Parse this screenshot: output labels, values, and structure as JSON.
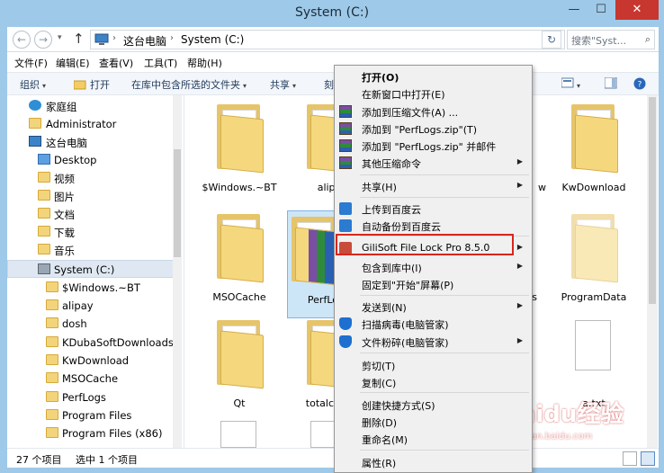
{
  "window": {
    "title": "System (C:)"
  },
  "titlebar": {
    "min_icon": "—",
    "max_icon": "☐",
    "close_icon": "✕"
  },
  "address": {
    "back_icon": "←",
    "forward_icon": "→",
    "recent_icon": "▾",
    "up_icon": "↑",
    "breadcrumbs": [
      "这台电脑",
      "System (C:)"
    ],
    "sep_icon": "›",
    "dropdown_icon": "▾",
    "refresh_icon": "↻",
    "search_placeholder": "搜索\"Syst...",
    "search_icon": "⌕"
  },
  "menubar": {
    "items": [
      "文件(F)",
      "编辑(E)",
      "查看(V)",
      "工具(T)",
      "帮助(H)"
    ]
  },
  "toolbar": {
    "organize": "组织",
    "open": "打开",
    "include_in_library": "在库中包含所选的文件夹",
    "share": "共享",
    "burn": "刻",
    "arrow": "▾"
  },
  "navpane": {
    "items": [
      {
        "label": "家庭组",
        "kind": "homegroup"
      },
      {
        "label": "Administrator",
        "kind": "user"
      },
      {
        "label": "这台电脑",
        "kind": "pc"
      },
      {
        "label": "Desktop",
        "kind": "folder"
      },
      {
        "label": "视频",
        "kind": "folder"
      },
      {
        "label": "图片",
        "kind": "folder"
      },
      {
        "label": "文档",
        "kind": "folder"
      },
      {
        "label": "下载",
        "kind": "folder"
      },
      {
        "label": "音乐",
        "kind": "folder"
      },
      {
        "label": "System (C:)",
        "kind": "drive"
      },
      {
        "label": "$Windows.~BT",
        "kind": "folder"
      },
      {
        "label": "alipay",
        "kind": "folder"
      },
      {
        "label": "dosh",
        "kind": "folder"
      },
      {
        "label": "KDubaSoftDownloads",
        "kind": "folder"
      },
      {
        "label": "KwDownload",
        "kind": "folder"
      },
      {
        "label": "MSOCache",
        "kind": "folder"
      },
      {
        "label": "PerfLogs",
        "kind": "folder"
      },
      {
        "label": "Program Files",
        "kind": "folder"
      },
      {
        "label": "Program Files (x86)",
        "kind": "folder"
      }
    ]
  },
  "content": {
    "tiles": [
      {
        "label": "$Windows.~BT"
      },
      {
        "label": "alipa"
      },
      {
        "label": "w"
      },
      {
        "label": "KwDownload"
      },
      {
        "label": "MSOCache"
      },
      {
        "label": "PerfLo"
      },
      {
        "label": "s"
      },
      {
        "label": "ProgramData"
      },
      {
        "label": "Qt"
      },
      {
        "label": "totalc"
      },
      {
        "label": "a.txt"
      }
    ]
  },
  "status": {
    "item_count": "27 个项目",
    "selected": "选中 1 个项目"
  },
  "context_menu": {
    "items": [
      {
        "label": "打开(O)",
        "bold": true
      },
      {
        "label": "在新窗口中打开(E)"
      },
      {
        "label": "添加到压缩文件(A) ...",
        "icon": "rar-icon"
      },
      {
        "label": "添加到 \"PerfLogs.zip\"(T)",
        "icon": "rar-icon"
      },
      {
        "label": "添加到 \"PerfLogs.zip\" 并邮件",
        "icon": "rar-icon"
      },
      {
        "label": "其他压缩命令",
        "icon": "rar-icon",
        "submenu": true
      },
      {
        "label": "共享(H)",
        "submenu": true
      },
      {
        "label": "上传到百度云",
        "icon": "baidu-cloud-icon"
      },
      {
        "label": "自动备份到百度云",
        "icon": "baidu-cloud-icon"
      },
      {
        "label": "GiliSoft File Lock Pro 8.5.0",
        "icon": "lock-icon",
        "submenu": true
      },
      {
        "label": "包含到库中(I)",
        "submenu": true
      },
      {
        "label": "固定到\"开始\"屏幕(P)"
      },
      {
        "label": "发送到(N)",
        "submenu": true
      },
      {
        "label": "扫描病毒(电脑管家)",
        "icon": "shield-icon"
      },
      {
        "label": "文件粉碎(电脑管家)",
        "icon": "shield-icon",
        "submenu": true
      },
      {
        "label": "剪切(T)"
      },
      {
        "label": "复制(C)"
      },
      {
        "label": "创建快捷方式(S)"
      },
      {
        "label": "删除(D)"
      },
      {
        "label": "重命名(M)"
      },
      {
        "label": "属性(R)"
      }
    ],
    "submenu_arrow": "▶"
  },
  "watermark": {
    "main": "Baidu经验",
    "sub": "jingyan.baidu.com"
  },
  "colors": {
    "highlight_border": "#d9261c",
    "title_bg": "#9ec9e8",
    "close_bg": "#c7372f"
  }
}
